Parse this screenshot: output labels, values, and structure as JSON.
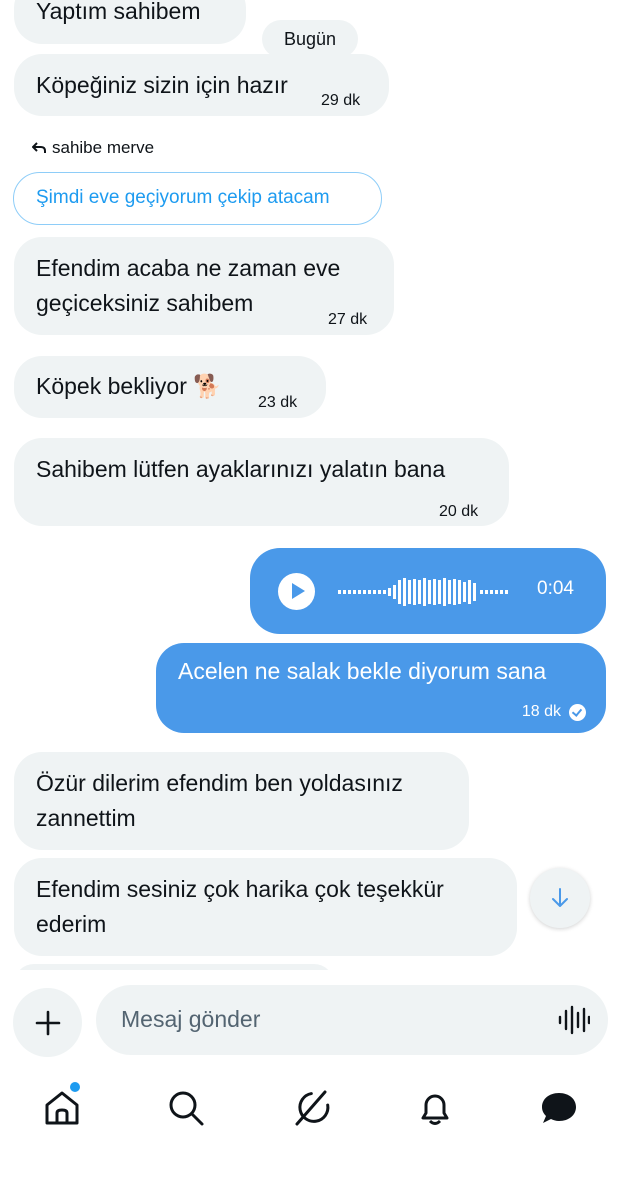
{
  "chat": {
    "date_label": "Bugün",
    "messages": [
      {
        "text": "Yaptım sahibem"
      },
      {
        "text": "Köpeğiniz sizin için hazır",
        "time": "29 dk"
      },
      {
        "reply_to": "sahibe merve",
        "quoted": "Şimdi eve geçiyorum çekip atacam"
      },
      {
        "line1": "Efendim acaba ne zaman eve",
        "line2": "geçiceksiniz sahibem",
        "time": "27 dk"
      },
      {
        "text": "Köpek bekliyor 🐕",
        "time": "23 dk"
      },
      {
        "text": "Sahibem lütfen ayaklarınızı yalatın bana",
        "time": "20 dk"
      },
      {
        "line1": "Özür dilerim efendim ben yoldasınız",
        "line2": "zannettim"
      },
      {
        "line1": "Efendim sesiniz çok harika çok teşekkür",
        "line2": "ederim"
      }
    ],
    "voice": {
      "duration": "0:04"
    },
    "outgoing": {
      "text": "Acelen ne salak bekle diyorum sana",
      "time": "18 dk"
    }
  },
  "composer": {
    "placeholder": "Mesaj gönder"
  },
  "tabs": [
    "home-icon",
    "search-icon",
    "grok-icon",
    "bell-icon",
    "messages-icon"
  ],
  "colors": {
    "accent": "#4a99e9",
    "bubble_in": "#eff3f4",
    "link": "#1d9bf0"
  }
}
